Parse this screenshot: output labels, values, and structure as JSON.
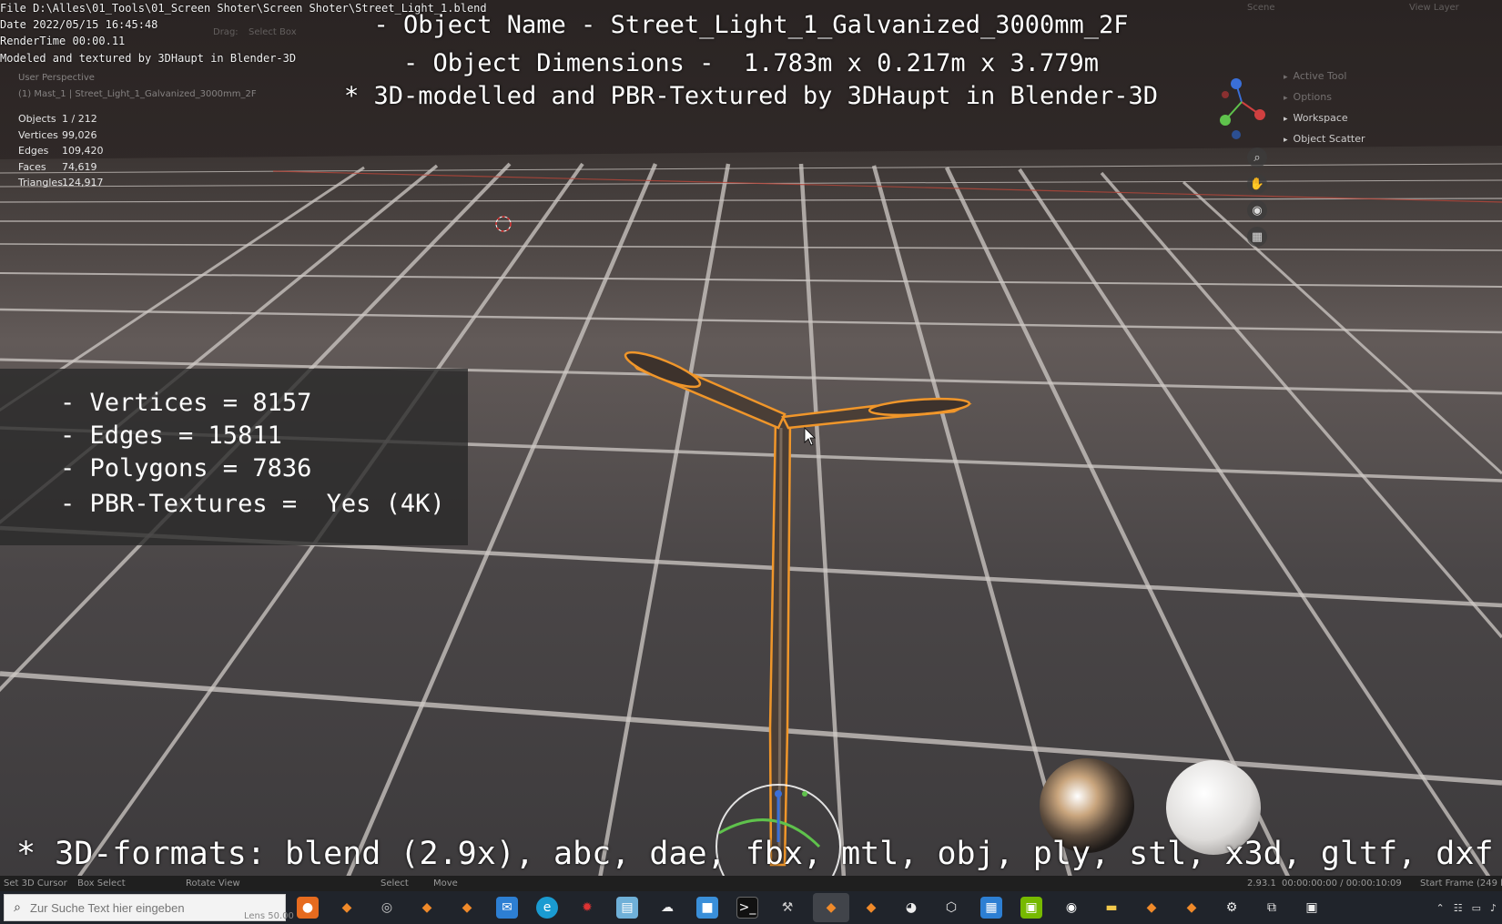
{
  "stamp": {
    "file": "File D:\\Alles\\01_Tools\\01_Screen Shoter\\Screen Shoter\\Street_Light_1.blend",
    "date": "Date 2022/05/15 16:45:48",
    "render_time": "RenderTime 00:00.11",
    "modeled_by": "Modeled and textured by 3DHaupt in Blender-3D"
  },
  "header": {
    "drag_label": "Drag:",
    "drag_value": "Select Box",
    "scene": "Scene",
    "view_layer": "View Layer"
  },
  "overlay": {
    "title_1": "- Object Name - Street_Light_1_Galvanized_3000mm_2F",
    "title_2": "- Object Dimensions -  1.783m x 0.217m x 3.779m",
    "title_3": "* 3D-modelled and PBR-Textured by 3DHaupt in Blender-3D",
    "formats": "* 3D-formats: blend (2.9x), abc, dae, fbx, mtl, obj, ply, stl, x3d, gltf, dxf"
  },
  "viewport": {
    "view_name": "User Perspective",
    "collection": "(1) Mast_1 | Street_Light_1_Galvanized_3000mm_2F",
    "stats": [
      {
        "key": "Objects",
        "value": "1 / 212"
      },
      {
        "key": "Vertices",
        "value": "99,026"
      },
      {
        "key": "Edges",
        "value": "109,420"
      },
      {
        "key": "Faces",
        "value": "74,619"
      },
      {
        "key": "Triangles",
        "value": "124,917"
      }
    ]
  },
  "info_panel": {
    "line_1": "- Vertices = 8157",
    "line_2": "- Edges = 15811",
    "line_3": "- Polygons = 7836",
    "line_4": "- PBR-Textures =  Yes (4K)"
  },
  "side_panel": {
    "items": [
      "Active Tool",
      "Options",
      "Workspace",
      "Object Scatter"
    ]
  },
  "statusbar": {
    "cursor": "Set 3D Cursor",
    "box_select": "Box Select",
    "rotate": "Rotate View",
    "select": "Select",
    "move": "Move",
    "version": "2.93.1",
    "timecode": "00:00:00:00 / 00:00:10:09",
    "start_frame": "Start Frame (249 le"
  },
  "taskbar": {
    "search_placeholder": "Zur Suche Text hier eingeben",
    "lens": "Lens 50.00"
  },
  "colors": {
    "selection_outline": "#f0962a",
    "grid_line": "#cfcac6",
    "overlay_text": "#ffffff"
  }
}
